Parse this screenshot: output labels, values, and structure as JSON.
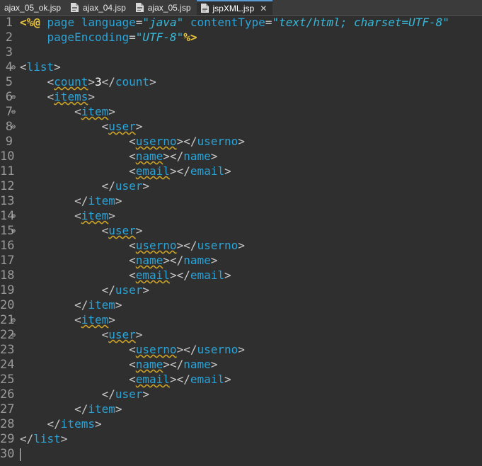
{
  "tabs": [
    {
      "label": "ajax_05_ok.jsp",
      "active": false
    },
    {
      "label": "ajax_04.jsp",
      "active": false
    },
    {
      "label": "ajax_05.jsp",
      "active": false
    },
    {
      "label": "jspXML.jsp",
      "active": true
    }
  ],
  "editor": {
    "lines": [
      {
        "n": "1",
        "fold": false
      },
      {
        "n": "2",
        "fold": false
      },
      {
        "n": "3",
        "fold": false
      },
      {
        "n": "4",
        "fold": true
      },
      {
        "n": "5",
        "fold": false
      },
      {
        "n": "6",
        "fold": true
      },
      {
        "n": "7",
        "fold": true
      },
      {
        "n": "8",
        "fold": true
      },
      {
        "n": "9",
        "fold": false
      },
      {
        "n": "10",
        "fold": false
      },
      {
        "n": "11",
        "fold": false
      },
      {
        "n": "12",
        "fold": false
      },
      {
        "n": "13",
        "fold": false
      },
      {
        "n": "14",
        "fold": true
      },
      {
        "n": "15",
        "fold": true
      },
      {
        "n": "16",
        "fold": false
      },
      {
        "n": "17",
        "fold": false
      },
      {
        "n": "18",
        "fold": false
      },
      {
        "n": "19",
        "fold": false
      },
      {
        "n": "20",
        "fold": false
      },
      {
        "n": "21",
        "fold": true
      },
      {
        "n": "22",
        "fold": true
      },
      {
        "n": "23",
        "fold": false
      },
      {
        "n": "24",
        "fold": false
      },
      {
        "n": "25",
        "fold": false
      },
      {
        "n": "26",
        "fold": false
      },
      {
        "n": "27",
        "fold": false
      },
      {
        "n": "28",
        "fold": false
      },
      {
        "n": "29",
        "fold": false
      },
      {
        "n": "30",
        "fold": false
      }
    ],
    "code": {
      "l1_open": "<%@",
      "l1_page": " page ",
      "l1_lang_attr": "language",
      "l1_lang_val": "\"java\"",
      "l1_ct_attr": " contentType",
      "l1_ct_val": "\"text/html; charset=UTF-8\"",
      "l2_pe_attr": "    pageEncoding",
      "l2_pe_val": "\"UTF-8\"",
      "l2_close": "%>",
      "eq": "=",
      "lt": "<",
      "gt": ">",
      "lts": "</",
      "list": "list",
      "count": "count",
      "count_value": "3",
      "items": "items",
      "item": "item",
      "user": "user",
      "userno": "userno",
      "name": "name",
      "email": "email"
    }
  }
}
